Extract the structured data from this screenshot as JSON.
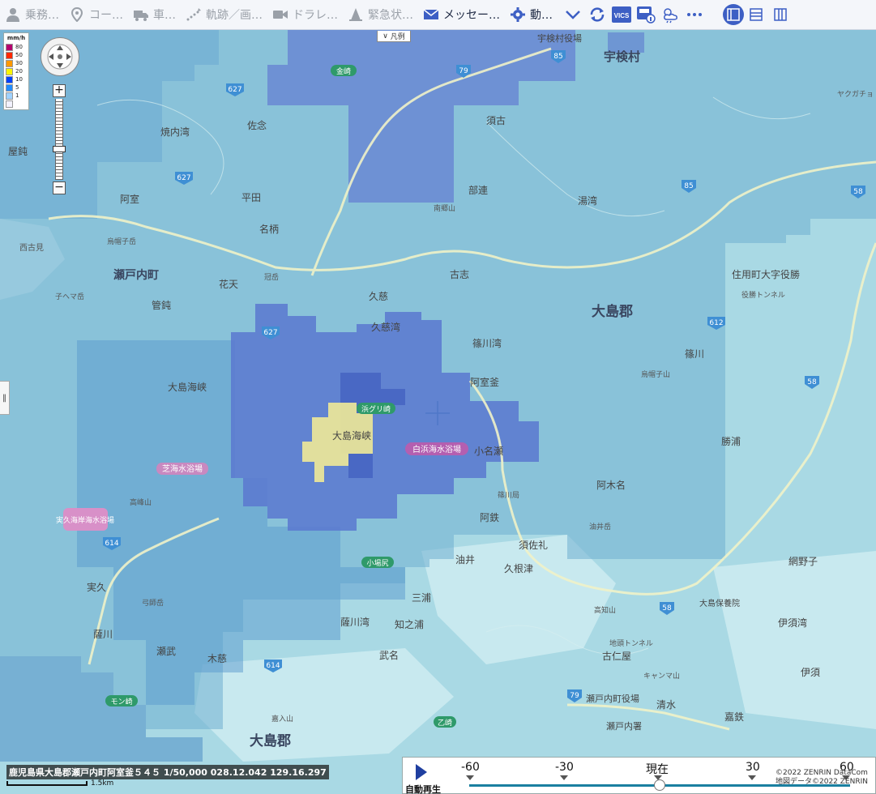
{
  "toolbar": {
    "items": [
      {
        "label": "乗務…",
        "icon": "person-icon",
        "active": false
      },
      {
        "label": "コー…",
        "icon": "map-pin-icon",
        "active": false
      },
      {
        "label": "車…",
        "icon": "truck-icon",
        "active": false
      },
      {
        "label": "軌跡／画…",
        "icon": "track-icon",
        "active": false
      },
      {
        "label": "ドラレ…",
        "icon": "video-icon",
        "active": false
      },
      {
        "label": "緊急状…",
        "icon": "warning-cone-icon",
        "active": false
      },
      {
        "label": "メッセー…",
        "icon": "envelope-icon",
        "active": true
      },
      {
        "label": "動…",
        "icon": "gear-icon",
        "active": true
      }
    ],
    "vics_label": "VICS"
  },
  "legend": {
    "unit": "mm/h",
    "levels": [
      {
        "label": "80",
        "color": "#b4006e"
      },
      {
        "label": "50",
        "color": "#ff2800"
      },
      {
        "label": "30",
        "color": "#ff9900"
      },
      {
        "label": "20",
        "color": "#faf500"
      },
      {
        "label": "10",
        "color": "#0041ff"
      },
      {
        "label": "5",
        "color": "#218cff"
      },
      {
        "label": "1",
        "color": "#a0d2ff"
      },
      {
        "label": "",
        "color": "#f2f2ff"
      }
    ]
  },
  "hanrei_label": "凡例",
  "coords_text": "鹿児島県大島郡瀬戸内町阿室釜５４５ 1/50,000 028.12.042 129.16.297",
  "scale_label": "1.5km",
  "timeline": {
    "autoplay_label": "自動再生",
    "ticks": [
      "-60",
      "-30",
      "現在",
      "30",
      "60"
    ],
    "current_fraction": 0.5
  },
  "copyright": [
    "©2022 ZENRIN DataCom",
    "地図データ©2022 ZENRIN"
  ],
  "map_labels": {
    "region_large": [
      "大島郡",
      "瀬戸内町",
      "宇検村",
      "大島郡"
    ],
    "places": [
      "佐念",
      "焼内湾",
      "屋鈍",
      "阿室",
      "平田",
      "名柄",
      "須古",
      "部連",
      "湯湾",
      "花天",
      "管鈍",
      "久慈",
      "古志",
      "篠川湾",
      "阿室釜",
      "小名瀬",
      "阿鉄",
      "須佐礼",
      "油井",
      "久根津",
      "篠川",
      "勝浦",
      "阿木名",
      "網野子",
      "伊須湾",
      "伊須",
      "古仁屋",
      "清水",
      "嘉鉄",
      "実久",
      "薩川",
      "瀬武",
      "木慈",
      "三浦",
      "知之浦",
      "武名",
      "薩川湾",
      "久慈湾",
      "大島海峡",
      "大島海峡",
      "住用町大字役勝",
      "西古見",
      "宇検村役場",
      "瀬戸内町役場",
      "瀬戸内署",
      "大島保養院"
    ],
    "small_places": [
      "烏帽子岳",
      "南郷山",
      "冠岳",
      "子ヘマ岳",
      "高知山",
      "油井岳",
      "弓師岳",
      "嘉入山",
      "高峰山",
      "篠川局",
      "キャンマ山",
      "地頭トンネル",
      "役勝トンネル",
      "ヤクガチョ",
      "烏帽子山"
    ],
    "beaches": [
      "白浜海水浴場",
      "芝海水浴場",
      "実久海岸海水浴場"
    ],
    "capes": [
      "金崎",
      "浜グリ崎",
      "小場尻",
      "モン崎",
      "乙崎"
    ],
    "routes": [
      "85",
      "79",
      "627",
      "627",
      "627",
      "85",
      "58",
      "612",
      "58",
      "614",
      "614",
      "79",
      "58"
    ]
  }
}
